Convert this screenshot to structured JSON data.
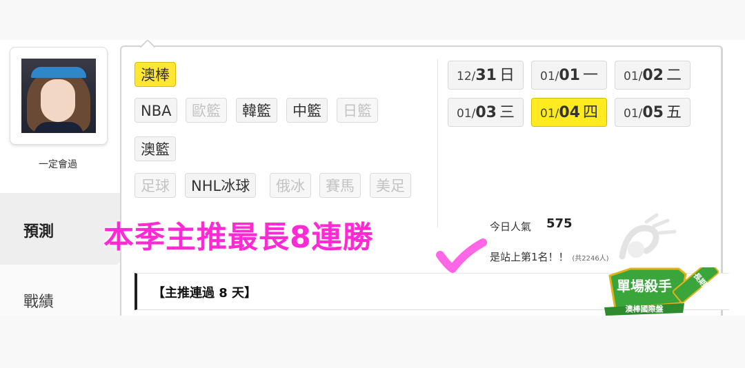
{
  "profile": {
    "username": "一定會過"
  },
  "nav": {
    "forecast": "預測",
    "record": "戰績"
  },
  "sports": {
    "row1": [
      {
        "label": "澳棒",
        "state": "active"
      }
    ],
    "row2": [
      {
        "label": "NBA",
        "state": "normal"
      },
      {
        "label": "歐籃",
        "state": "disabled"
      },
      {
        "label": "韓籃",
        "state": "normal"
      },
      {
        "label": "中籃",
        "state": "normal"
      },
      {
        "label": "日籃",
        "state": "disabled"
      }
    ],
    "row3": [
      {
        "label": "澳籃",
        "state": "normal"
      }
    ],
    "row4": [
      {
        "label": "足球",
        "state": "disabled"
      },
      {
        "label": "NHL冰球",
        "state": "normal"
      },
      {
        "label": "俄冰",
        "state": "disabled"
      },
      {
        "label": "賽馬",
        "state": "disabled"
      },
      {
        "label": "美足",
        "state": "disabled"
      }
    ]
  },
  "dates": [
    {
      "month": "12/",
      "day": "31",
      "weekday": "日",
      "active": false
    },
    {
      "month": "01/",
      "day": "01",
      "weekday": "一",
      "active": false
    },
    {
      "month": "01/",
      "day": "02",
      "weekday": "二",
      "active": false
    },
    {
      "month": "01/",
      "day": "03",
      "weekday": "三",
      "active": false
    },
    {
      "month": "01/",
      "day": "04",
      "weekday": "四",
      "active": true
    },
    {
      "month": "01/",
      "day": "05",
      "weekday": "五",
      "active": false
    }
  ],
  "stats": {
    "popularity_label": "今日人氣",
    "popularity_value": "575",
    "rank_text": "是站上第1名！！",
    "rank_sub": "(共2246人)"
  },
  "promo": {
    "text": "本季主推最長8連勝",
    "color": "#ff2ad4"
  },
  "section": {
    "header": "【主推連過 8 天】"
  },
  "badge": {
    "title": "單場殺手",
    "subtitle": "澳棒國際盤",
    "ribbon": "長期穩定"
  },
  "colors": {
    "active_chip": "#ffe733",
    "badge_green": "#3aa53a",
    "badge_gold": "#e3b21b"
  }
}
